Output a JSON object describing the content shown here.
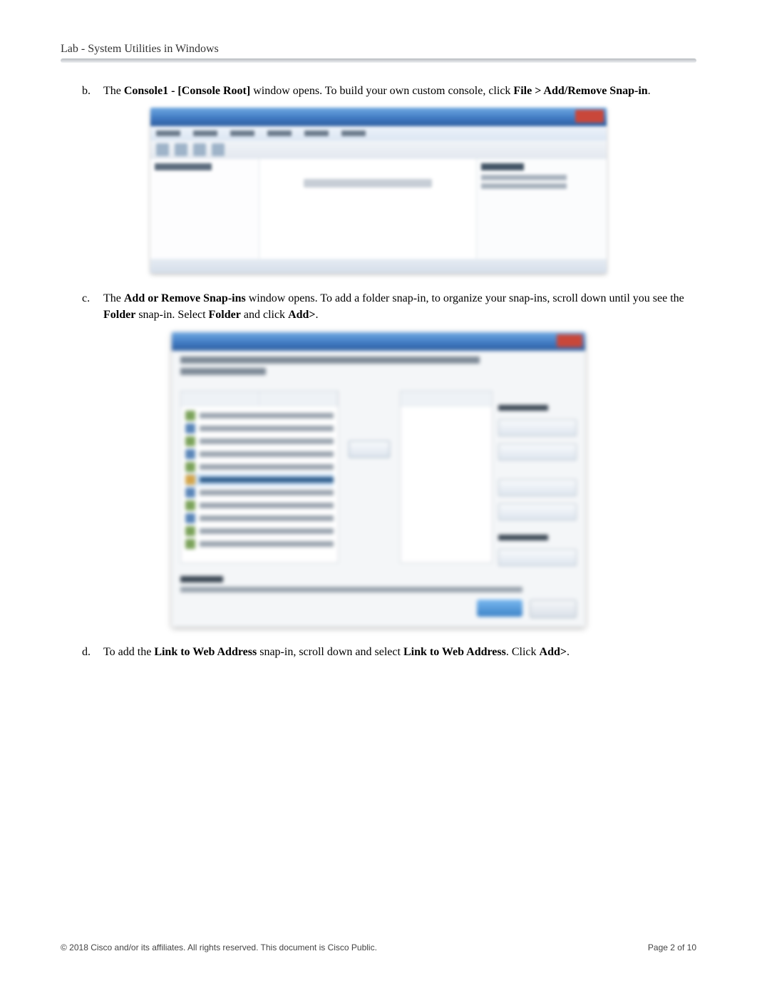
{
  "header": {
    "running": "Lab - System Utilities in Windows"
  },
  "steps": {
    "b": {
      "letter": "b.",
      "pre": "The ",
      "bold1": "Console1 - [Console Root]",
      "mid": " window opens. To build your own custom console, click ",
      "bold2": "File > Add/Remove Snap-in",
      "post": "."
    },
    "c": {
      "letter": "c.",
      "pre": "The ",
      "bold1": "Add or Remove Snap-ins",
      "mid1": " window opens. To add a folder snap-in, to organize your snap-ins, scroll down until you see the ",
      "bold2": "Folder",
      "mid2": " snap-in. Select ",
      "bold3": "Folder",
      "mid3": " and click ",
      "bold4": "Add>",
      "post": "."
    },
    "d": {
      "letter": "d.",
      "pre": "To add the ",
      "bold1": "Link to Web Address",
      "mid1": " snap-in, scroll down and select ",
      "bold2": "Link to Web Address",
      "mid2": ". Click ",
      "bold3": "Add>",
      "post": "."
    }
  },
  "footer": {
    "copyright": "© 2018 Cisco and/or its affiliates. All rights reserved. This document is Cisco Public.",
    "page_label": "Page ",
    "page_current": "2",
    "page_of": " of ",
    "page_total": "10"
  }
}
